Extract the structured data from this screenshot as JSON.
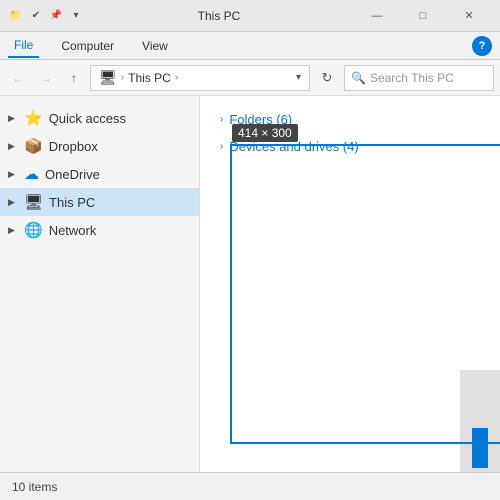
{
  "titleBar": {
    "title": "This PC",
    "minBtn": "—",
    "maxBtn": "□",
    "closeBtn": "✕"
  },
  "ribbon": {
    "tabs": [
      "File",
      "Computer",
      "View"
    ],
    "helpLabel": "?"
  },
  "addressBar": {
    "backBtn": "←",
    "forwardBtn": "→",
    "upBtn": "↑",
    "pathIcon": "🖥",
    "pathMain": "This PC",
    "pathChevron": "›",
    "refreshLabel": "↻",
    "searchPlaceholder": "Search This PC",
    "searchIcon": "🔍"
  },
  "sidebar": {
    "items": [
      {
        "label": "Quick access",
        "icon": "⭐",
        "hasArrow": true,
        "active": false
      },
      {
        "label": "Dropbox",
        "icon": "📦",
        "hasArrow": true,
        "active": false
      },
      {
        "label": "OneDrive",
        "icon": "☁",
        "hasArrow": true,
        "active": false
      },
      {
        "label": "This PC",
        "icon": "🖥",
        "hasArrow": true,
        "active": true
      },
      {
        "label": "Network",
        "icon": "🌐",
        "hasArrow": true,
        "active": false
      }
    ]
  },
  "fileArea": {
    "sections": [
      {
        "label": "Folders (6)",
        "chevron": "›"
      },
      {
        "label": "Devices and drives (4)",
        "chevron": "›"
      }
    ]
  },
  "selectionOverlay": {
    "sizeTooltip": "414 × 300"
  },
  "statusBar": {
    "itemCount": "10 items"
  }
}
